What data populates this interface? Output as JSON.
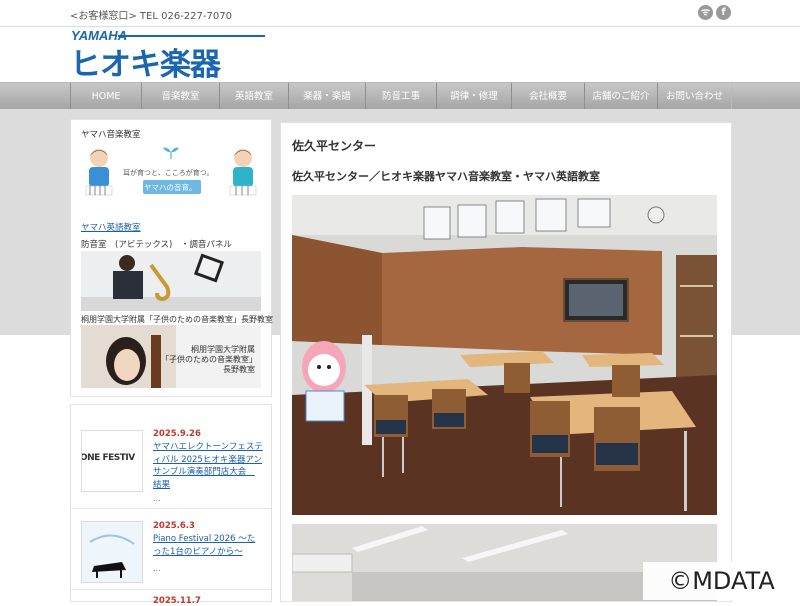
{
  "header": {
    "contact": "<お客様窓口> TEL 026-227-7070",
    "social": [
      {
        "icon": "rss-icon",
        "glyph": "ᯤ"
      },
      {
        "icon": "facebook-icon",
        "glyph": "f"
      }
    ],
    "logo": {
      "brand": "YAMAHA",
      "name": "ヒオキ楽器"
    }
  },
  "nav": {
    "items": [
      "HOME",
      "音楽教室",
      "英語教室",
      "楽器・楽譜",
      "防音工事",
      "調律・修理",
      "会社概要",
      "店舗のご紹介",
      "お問い合わせ"
    ]
  },
  "sidebar": {
    "music_school_title": "ヤマハ音楽教室",
    "music_banner_text": "耳が育つと、こころが育つ。",
    "music_banner_logo": "ヤマハの音育。",
    "english_school_link": "ヤマハ英語教室",
    "soundproof_title": "防音室　(アビテックス)　・調音パネル",
    "toho_title": "桐朋学園大学附属「子供のための音楽教室」長野教室",
    "toho_banner_lines": [
      "桐朋学園大学附属",
      "「子供のための音楽教室」",
      "長野教室"
    ]
  },
  "news": [
    {
      "date": "2025.9.26",
      "title": "ヤマハエレクトーンフェスティバル 2025ヒオキ楽器アンサンブル演奏部門店大会　結果",
      "more": "...",
      "thumb_text": "ONE FESTIV"
    },
    {
      "date": "2025.6.3",
      "title": "Piano Festival 2026 ～たった1台のピアノから～",
      "more": "...",
      "thumb_text": ""
    },
    {
      "date": "2025.11.7",
      "title": "",
      "more": "",
      "thumb_text": ""
    }
  ],
  "main": {
    "heading": "佐久平センター",
    "subheading": "佐久平センター／ヒオキ楽器ヤマハ音楽教室・ヤマハ英語教室"
  },
  "watermark": "©MDATA",
  "colors": {
    "brand_blue": "#1a66b0",
    "link_blue": "#1d5fa8",
    "date_red": "#c0392b",
    "nav_gray": "#a4a4a4"
  }
}
